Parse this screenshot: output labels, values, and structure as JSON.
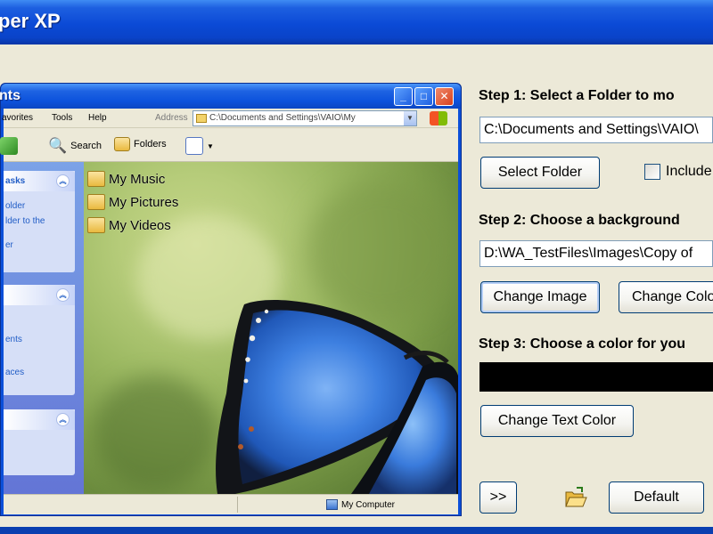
{
  "app": {
    "title": "per XP"
  },
  "preview": {
    "title": "nts",
    "menu": [
      "avorites",
      "Tools",
      "Help"
    ],
    "address_label": "Address",
    "address_value": "C:\\Documents and Settings\\VAIO\\My",
    "toolbar": {
      "search_label": "Search",
      "folders_label": "Folders"
    },
    "tasks": [
      {
        "header": "asks",
        "links": [
          "older",
          "lder to the",
          "er"
        ]
      },
      {
        "header": "",
        "links": [
          "ents",
          "aces"
        ]
      },
      {
        "header": "",
        "links": []
      }
    ],
    "folders": [
      "My Music",
      "My Pictures",
      "My Videos"
    ],
    "status_location": "My Computer"
  },
  "settings": {
    "step1_label": "Step 1:  Select a Folder to mo",
    "folder_path": "C:\\Documents and Settings\\VAIO\\",
    "select_folder_label": "Select Folder",
    "include_label": "Include",
    "step2_label": "Step 2:  Choose a background",
    "image_path": "D:\\WA_TestFiles\\Images\\Copy of",
    "change_image_label": "Change Image",
    "change_color_label": "Change Colo",
    "step3_label": "Step 3:  Choose a color for you",
    "text_color": "#000000",
    "change_text_color_label": "Change Text Color",
    "next_label": ">>",
    "default_label": "Default"
  }
}
